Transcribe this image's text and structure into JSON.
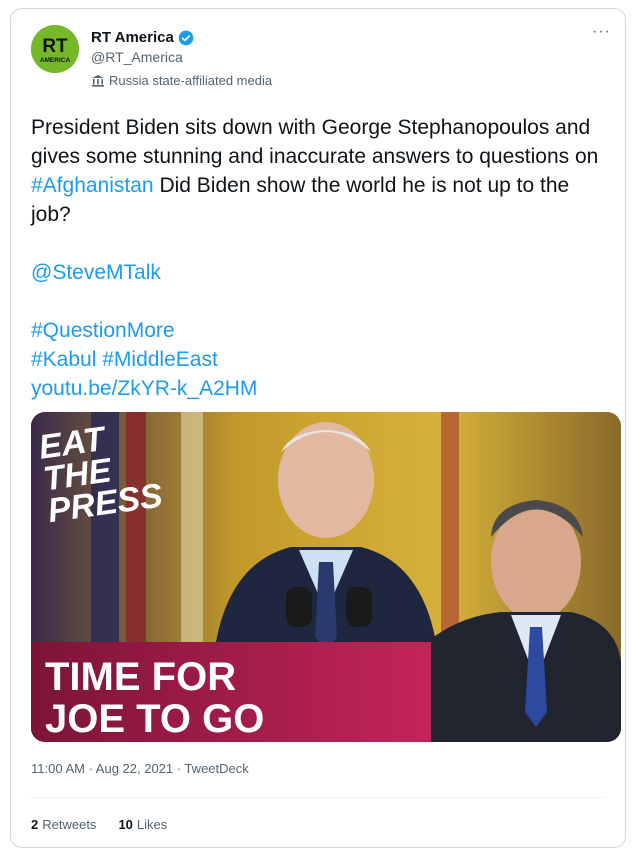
{
  "account": {
    "name": "RT America",
    "handle": "@RT_America",
    "affiliation": "Russia state-affiliated media",
    "avatar_text_top": "RT",
    "avatar_text_bottom": "AMERICA"
  },
  "more_label": "···",
  "tweet": {
    "line1_prefix": "President Biden sits down with George Stephanopoulos and gives some stunning and inaccurate answers to questions on ",
    "hashtag_afghanistan": "#Afghanistan",
    "line1_suffix": " Did Biden show the world he is not up to the job?",
    "mention": "@SteveMTalk",
    "hashtag_question": "#QuestionMore",
    "hashtag_kabul": "#Kabul",
    "hashtag_middleeast": "#MiddleEast",
    "url": "youtu.be/ZkYR-k_A2HM"
  },
  "media": {
    "overlay_top_1": "EAT",
    "overlay_top_2": "THE",
    "overlay_top_3": "PRESS",
    "overlay_bottom_1": "TIME FOR",
    "overlay_bottom_2": "JOE TO GO"
  },
  "meta": {
    "time": "11:00 AM · Aug 22, 2021 · TweetDeck"
  },
  "stats": {
    "retweets_count": "2",
    "retweets_label": "Retweets",
    "likes_count": "10",
    "likes_label": "Likes"
  },
  "colors": {
    "link": "#1d9bf0",
    "verified": "#1d9bf0",
    "avatar_bg": "#77b82a",
    "banner": "#b0184a"
  }
}
